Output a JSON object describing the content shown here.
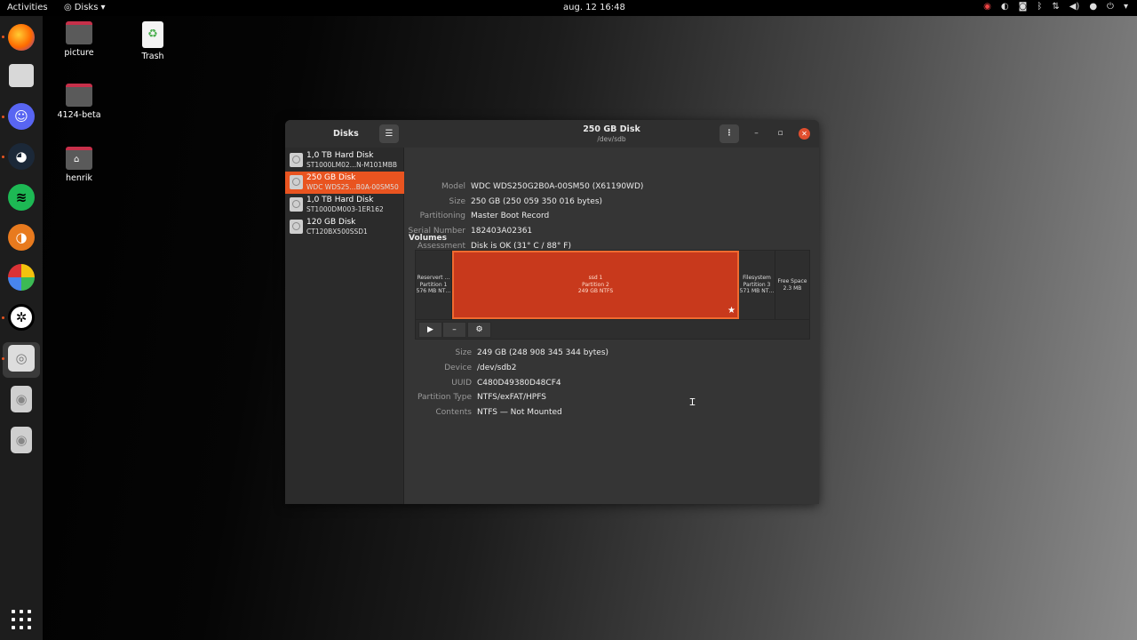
{
  "topbar": {
    "activities": "Activities",
    "app_name": "Disks",
    "clock": "aug. 12  16:48"
  },
  "desktop": {
    "icons": [
      {
        "label": "picture"
      },
      {
        "label": "Trash"
      },
      {
        "label": "4124-beta"
      },
      {
        "label": "henrik"
      }
    ]
  },
  "window": {
    "sidebar_title": "Disks",
    "title": "250 GB Disk",
    "subtitle": "/dev/sdb"
  },
  "disks": [
    {
      "name": "1,0 TB Hard Disk",
      "model": "ST1000LM02…N-M101MBB"
    },
    {
      "name": "250 GB Disk",
      "model": "WDC WDS25…B0A-00SM50"
    },
    {
      "name": "1,0 TB Hard Disk",
      "model": "ST1000DM003-1ER162"
    },
    {
      "name": "120 GB Disk",
      "model": "CT120BX500SSD1"
    }
  ],
  "disk_info": {
    "model_label": "Model",
    "model": "WDC WDS250G2B0A-00SM50 (X61190WD)",
    "size_label": "Size",
    "size": "250 GB (250 059 350 016 bytes)",
    "partitioning_label": "Partitioning",
    "partitioning": "Master Boot Record",
    "serial_label": "Serial Number",
    "serial": "182403A02361",
    "assessment_label": "Assessment",
    "assessment": "Disk is OK (31° C / 88° F)"
  },
  "volumes_title": "Volumes",
  "volumes": [
    {
      "l1": "Reservert …",
      "l2": "Partition 1",
      "l3": "576 MB NT…"
    },
    {
      "l1": "ssd 1",
      "l2": "Partition 2",
      "l3": "249 GB NTFS"
    },
    {
      "l1": "Filesystem",
      "l2": "Partition 3",
      "l3": "571 MB NT…"
    },
    {
      "l1": "Free Space",
      "l2": "2.3 MB",
      "l3": ""
    }
  ],
  "volume_info": {
    "size_label": "Size",
    "size": "249 GB (248 908 345 344 bytes)",
    "device_label": "Device",
    "device": "/dev/sdb2",
    "uuid_label": "UUID",
    "uuid": "C480D49380D48CF4",
    "ptype_label": "Partition Type",
    "ptype": "NTFS/exFAT/HPFS",
    "contents_label": "Contents",
    "contents": "NTFS — Not Mounted"
  },
  "colors": {
    "accent": "#e95420",
    "close": "#e04e2e"
  }
}
